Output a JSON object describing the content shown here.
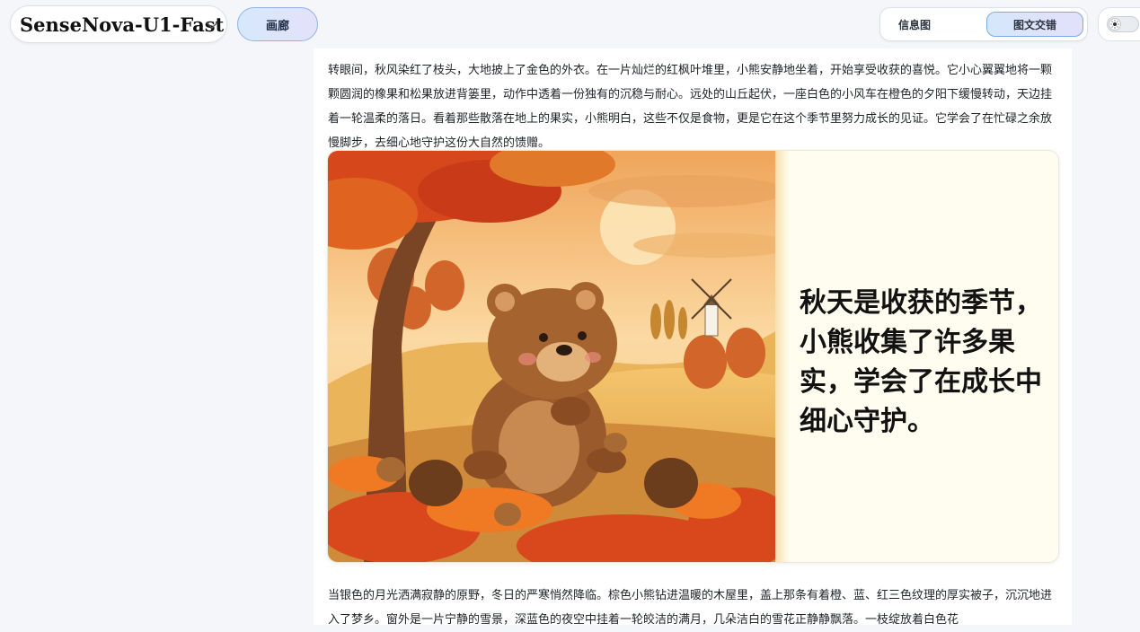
{
  "header": {
    "model_name": "SenseNova-U1-Fast",
    "gallery_label": "画廊",
    "modes": [
      {
        "label": "信息图",
        "active": false
      },
      {
        "label": "图文交错",
        "active": true
      }
    ],
    "theme_icon": "sun-icon"
  },
  "story": {
    "paragraph_1": "转眼间，秋风染红了枝头，大地披上了金色的外衣。在一片灿烂的红枫叶堆里，小熊安静地坐着，开始享受收获的喜悦。它小心翼翼地将一颗颗圆润的橡果和松果放进背篓里，动作中透着一份独有的沉稳与耐心。远处的山丘起伏，一座白色的小风车在橙色的夕阳下缓慢转动，天边挂着一轮温柔的落日。看着那些散落在地上的果实，小熊明白，这些不仅是食物，更是它在这个季节里努力成长的见证。它学会了在忙碌之余放慢脚步，去细心地守护这份大自然的馈赠。",
    "image_caption": "秋天是收获的季节，小熊收集了许多果实，学会了在成长中细心守护。",
    "paragraph_2": "当银色的月光洒满寂静的原野，冬日的严寒悄然降临。棕色小熊钻进温暖的木屋里，盖上那条有着橙、蓝、红三色纹理的厚实被子，沉沉地进入了梦乡。窗外是一片宁静的雪景，深蓝色的夜空中挂着一轮皎洁的满月，几朵洁白的雪花正静静飘落。一枝绽放着白色花"
  },
  "colors": {
    "accent_border": "#8fb2ee",
    "accent_gradient_start": "#d6e8fb",
    "accent_gradient_end": "#e4e1fb",
    "page_background": "#f4f6fa"
  }
}
